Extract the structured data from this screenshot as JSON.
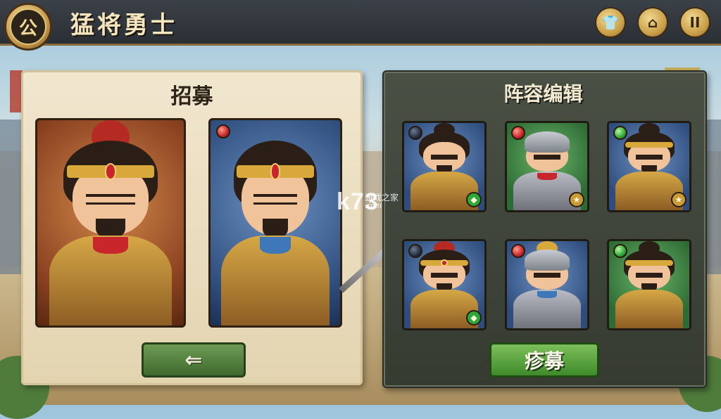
{
  "header": {
    "logo_char": "公",
    "title": "猛将勇士",
    "buttons": [
      {
        "name": "armor-button",
        "icon": "armor-icon",
        "glyph": "👕"
      },
      {
        "name": "home-button",
        "icon": "home-icon",
        "glyph": "⌂"
      },
      {
        "name": "pause-button",
        "icon": "pause-icon",
        "glyph": "II"
      }
    ]
  },
  "recruit_panel": {
    "title": "招募",
    "back_glyph": "⇐"
  },
  "lineup_panel": {
    "title": "阵容编辑",
    "recruit_button_label": "疹募",
    "cards": [
      {
        "bg": "blue",
        "orb": "dark",
        "rank": "green"
      },
      {
        "bg": "green",
        "orb": "red",
        "rank": "gold"
      },
      {
        "bg": "blue",
        "orb": "green",
        "rank": "gold"
      },
      {
        "bg": "blue",
        "orb": "dark",
        "rank": "green"
      },
      {
        "bg": "blue",
        "orb": "red",
        "rank": "none"
      },
      {
        "bg": "green",
        "orb": "green",
        "rank": "none"
      }
    ]
  },
  "watermark": {
    "logo": "k73",
    "cn": "游戏之家",
    "com": ".com"
  },
  "colors": {
    "accent_gold": "#c79b45",
    "button_green": "#3f8a2c",
    "panel_dark": "#3f443a",
    "panel_paper": "#ebdfc2"
  }
}
